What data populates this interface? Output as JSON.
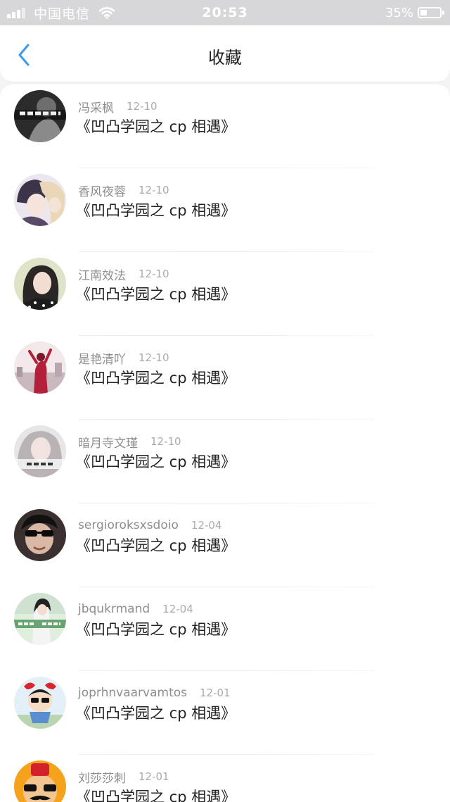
{
  "status_bar": {
    "carrier": "中国电信",
    "time": "20:53",
    "battery": "35%",
    "battery_level_percent": 35
  },
  "header": {
    "title": "收藏",
    "back_icon": "chevron-left-icon",
    "back_color": "#3a9be8"
  },
  "items": [
    {
      "author": "冯采枫",
      "date": "12-10",
      "title": "《凹凸学园之 cp 相遇》"
    },
    {
      "author": "香风夜蓉",
      "date": "12-10",
      "title": "《凹凸学园之 cp 相遇》"
    },
    {
      "author": "江南效法",
      "date": "12-10",
      "title": "《凹凸学园之 cp 相遇》"
    },
    {
      "author": "是艳清吖",
      "date": "12-10",
      "title": "《凹凸学园之 cp 相遇》"
    },
    {
      "author": "暗月寺文瑾",
      "date": "12-10",
      "title": "《凹凸学园之 cp 相遇》"
    },
    {
      "author": "sergioroksxsdoio",
      "date": "12-04",
      "title": "《凹凸学园之 cp 相遇》"
    },
    {
      "author": "jbqukrmand",
      "date": "12-04",
      "title": "《凹凸学园之 cp 相遇》"
    },
    {
      "author": "joprhnvaarvamtos",
      "date": "12-01",
      "title": "《凹凸学园之 cp 相遇》"
    },
    {
      "author": "刘莎莎刺",
      "date": "12-01",
      "title": "《凹凸学园之 cp 相遇》"
    }
  ]
}
